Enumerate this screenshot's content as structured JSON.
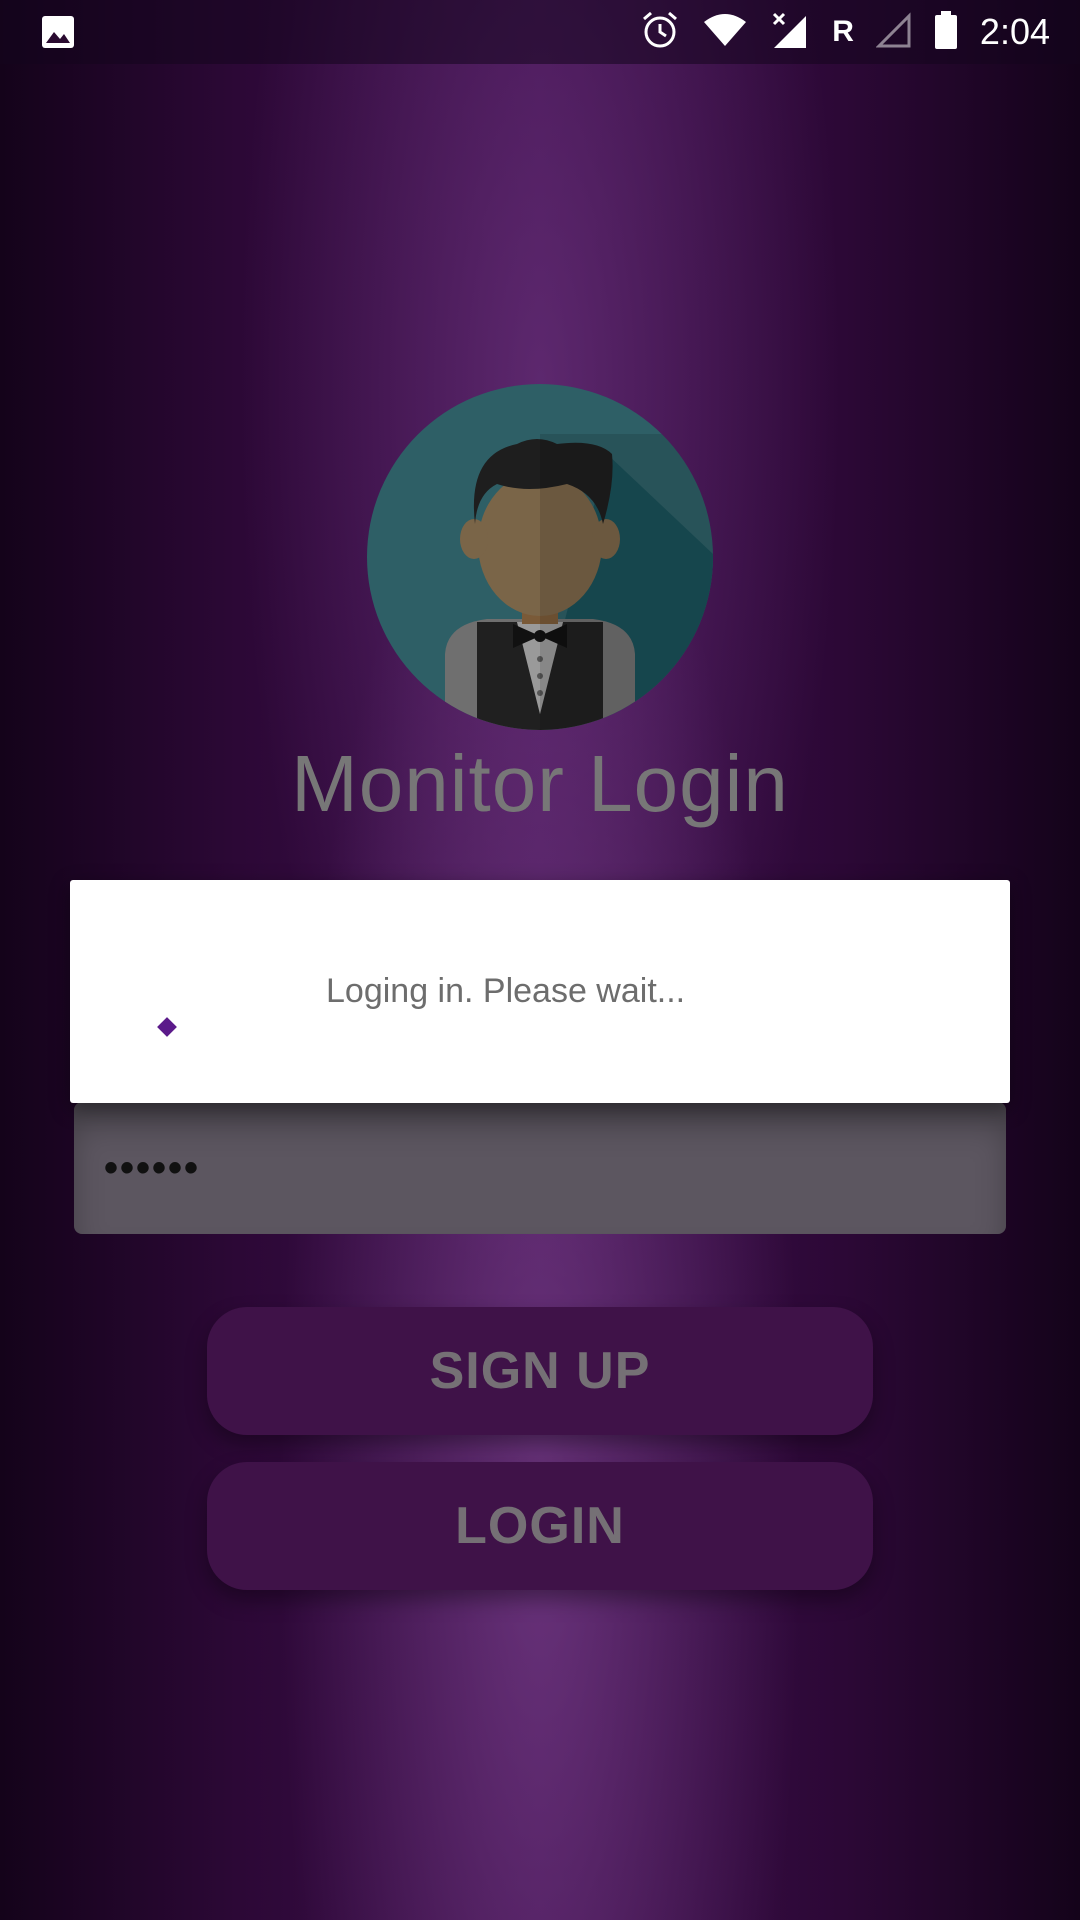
{
  "status_bar": {
    "time": "2:04",
    "network_label": "R",
    "icons": [
      "image-icon",
      "alarm-icon",
      "wifi-icon",
      "signal-icon",
      "signal-empty-icon",
      "battery-icon"
    ]
  },
  "app": {
    "title": "Monitor Login",
    "avatar_icon": "waiter-avatar-icon"
  },
  "dialog": {
    "message": "Loging in. Please wait..."
  },
  "form": {
    "password_value": "••••••"
  },
  "buttons": {
    "signup_label": "SIGN UP",
    "login_label": "LOGIN"
  },
  "colors": {
    "background": "#3e0f4d",
    "button": "#3f1248",
    "accent": "#5b1a8a"
  }
}
